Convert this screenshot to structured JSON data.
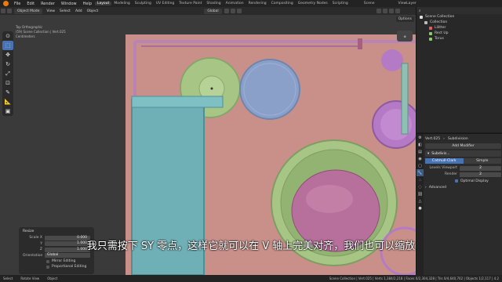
{
  "topbar": {
    "menus": [
      "File",
      "Edit",
      "Render",
      "Window",
      "Help"
    ],
    "workspaces": [
      "Layout",
      "Modeling",
      "Sculpting",
      "UV Editing",
      "Texture Paint",
      "Shading",
      "Animation",
      "Rendering",
      "Compositing",
      "Geometry Nodes",
      "Scripting"
    ],
    "active_workspace": "Layout",
    "scene": "Scene",
    "view_layer": "ViewLayer"
  },
  "header": {
    "mode": "Object Mode",
    "menus": [
      "View",
      "Select",
      "Add",
      "Object"
    ],
    "transform_orientation": "Global",
    "options": "Options"
  },
  "viewport": {
    "view_name": "Top Orthographic",
    "collection": "(59) Scene Collection | Vert.025",
    "units": "Centimeters"
  },
  "toolbar": {
    "tools": [
      "cursor-icon",
      "select-box-icon",
      "move-icon",
      "rotate-icon",
      "scale-icon",
      "transform-icon",
      "annotate-icon",
      "measure-icon",
      "add-cube-icon"
    ]
  },
  "resize_panel": {
    "title": "Resize",
    "scale_label": "Scale X",
    "y_label": "Y",
    "z_label": "Z",
    "scale_x": "0.000",
    "scale_y": "1.000",
    "scale_z": "1.000",
    "orientation_label": "Orientation",
    "orientation_value": "Global",
    "mirror_editing": "Mirror Editing",
    "proportional_editing": "Proportional Editing"
  },
  "subtitle": "我只需按下 SY 零点，这样它就可以在 V 轴上完美对齐，我们也可以缩放",
  "outliner": {
    "title": "Scene Collection",
    "rows": [
      "Collection",
      "Lilitter",
      "Rect Up",
      "Torus"
    ]
  },
  "properties": {
    "object_name": "Vert.025",
    "modifier_context": "Subdivision",
    "add_modifier": "Add Modifier",
    "modifier_name": "Subdivis...",
    "mode_a": "Catmull-Clark",
    "mode_b": "Simple",
    "levels_viewport_label": "Levels Viewport",
    "levels_viewport": "2",
    "render_label": "Render",
    "render": "2",
    "optimal_display": "Optimal Display",
    "advanced": "Advanced"
  },
  "statusbar": {
    "left_a": "Select",
    "left_b": "Rotate View",
    "left_c": "Object",
    "right": "Scene Collection | Vert.025 | Verts 1,384/2,218 | Faces 0/2,304,328 | Tris 0/4,640,702 | Objects 1/2,117 | 4.2"
  },
  "colors": {
    "board": "#c9908a",
    "accent": "#4772b3",
    "teal": "#6fb0b6",
    "green": "#a7c686",
    "blue": "#8aa0c8",
    "pink": "#b76f9b",
    "purple": "#b57ac5"
  }
}
